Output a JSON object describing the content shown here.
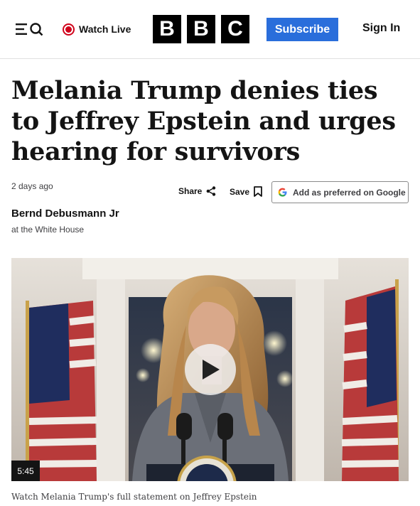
{
  "header": {
    "menu_icon": "menu-search-icon",
    "watch_live_label": "Watch Live",
    "logo_letters": [
      "B",
      "B",
      "C"
    ],
    "subscribe_label": "Subscribe",
    "signin_label": "Sign In",
    "accent_color": "#2a6edb",
    "live_color": "#d0021b"
  },
  "article": {
    "headline": "Melania Trump denies ties to Jeffrey Epstein and urges hearing for survivors",
    "timestamp": "2 days ago",
    "share_label": "Share",
    "save_label": "Save",
    "google_label": "Add as preferred on Google",
    "author_name": "Bernd Debusmann Jr",
    "author_role": "at the White House"
  },
  "video": {
    "duration": "5:45",
    "caption": "Watch Melania Trump's full statement on Jeffrey Epstein"
  }
}
